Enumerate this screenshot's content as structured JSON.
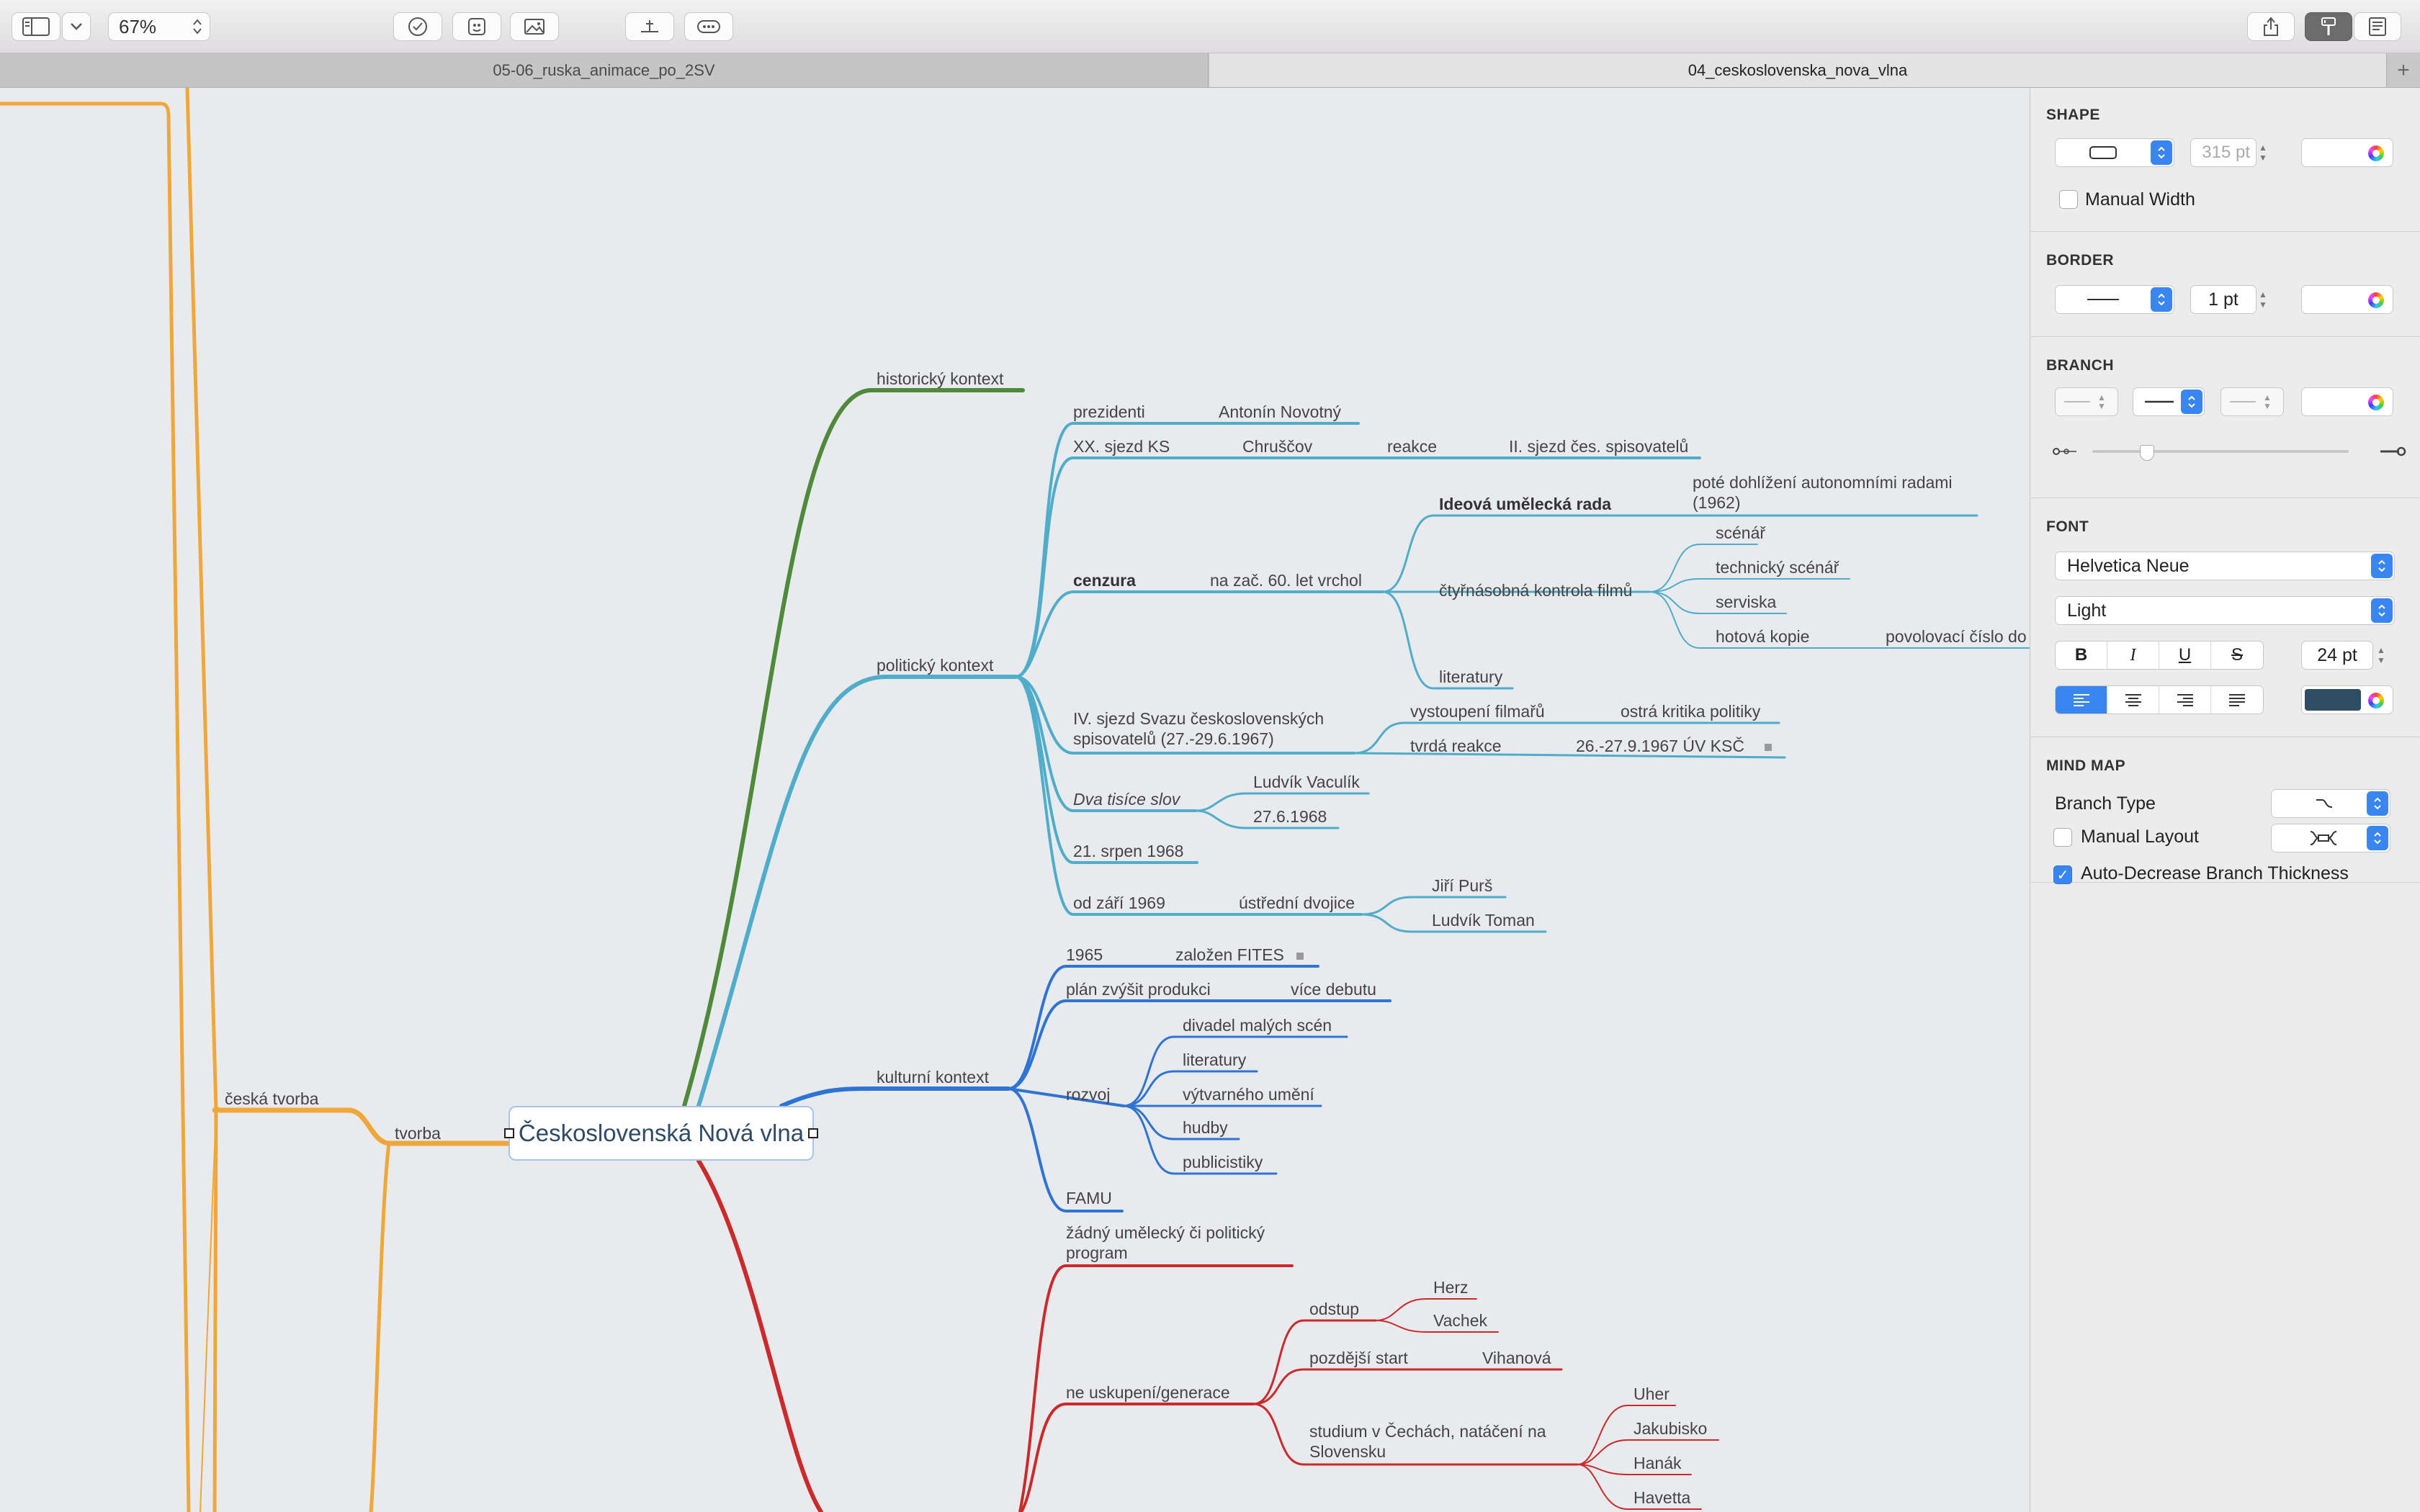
{
  "toolbar": {
    "zoom": "67%",
    "icons": [
      "sidebar-icon",
      "chevron-down-icon",
      "checkmark-icon",
      "sticker-icon",
      "image-icon",
      "add-subtopic-icon",
      "relationship-icon",
      "share-icon",
      "format-brush-icon",
      "document-icon"
    ]
  },
  "tabs": [
    "05-06_ruska_animace_po_2SV",
    "04_ceskoslovenska_nova_vlna"
  ],
  "colors": {
    "orange": "#f0a73a",
    "green": "#4e8a3a",
    "teal": "#4fadca",
    "blue": "#2f74d2",
    "red": "#cc2a2a",
    "accent": "#3a86f0"
  },
  "mindmap": {
    "central": "Československá Nová vlna",
    "left": {
      "ceska_tvorba": "česká tvorba",
      "tvorba": "tvorba"
    },
    "historicky": "historický kontext",
    "politicky": {
      "label": "politický kontext",
      "prezidenti": "prezidenti",
      "novotny": "Antonín Novotný",
      "xx_sjezd": "XX. sjezd KS",
      "chruscov": "Chruščov",
      "reakce": "reakce",
      "ii_sjezd": "II. sjezd čes. spisovatelů",
      "cenzura": "cenzura",
      "vrchol": "na zač. 60. let vrchol",
      "ideova": "Ideová umělecká rada",
      "pote": "poté dohlížení autonomními radami (1962)",
      "ctyrnasobna": "čtyřnásobná kontrola filmů",
      "scenar": "scénář",
      "technicky": "technický scénář",
      "serviska": "serviska",
      "hotova": "hotová kopie",
      "povolovaci": "povolovací číslo do",
      "literatury": "literatury",
      "iv_sjezd": "IV. sjezd Svazu československých spisovatelů (27.-29.6.1967)",
      "vystoupeni": "vystoupení filmařů",
      "ostra": "ostrá kritika politiky",
      "tvrda": "tvrdá reakce",
      "uv_ksc": "26.-27.9.1967 ÚV KSČ",
      "dva_tisice": "Dva tisíce slov",
      "vaculik": "Ludvík Vaculík",
      "datum_dts": "27.6.1968",
      "srpen": "21. srpen 1968",
      "od_zari": "od září 1969",
      "ustredni": "ústřední dvojice",
      "purs": "Jiří Purš",
      "toman": "Ludvík Toman"
    },
    "kulturni": {
      "label": "kulturní kontext",
      "rok_1965": "1965",
      "fites": "založen FITES",
      "plan": "plán zvýšit produkci",
      "vice_debutu": "více debutu",
      "rozvoj": "rozvoj",
      "divadel": "divadel malých scén",
      "literatury": "literatury",
      "vytvarneho": "výtvarného umění",
      "hudby": "hudby",
      "publicistiky": "publicistiky",
      "famu": "FAMU"
    },
    "red": {
      "zadny": "žádný umělecký či politický program",
      "ne_uskupeni": "ne uskupení/generace",
      "odstup": "odstup",
      "herz": "Herz",
      "vachek": "Vachek",
      "pozdejsi": "pozdější start",
      "vihanova": "Vihanová",
      "studium": "studium v Čechách, natáčení na Slovensku",
      "uher": "Uher",
      "jakubisko": "Jakubisko",
      "hanak": "Hanák",
      "havetta": "Havetta"
    }
  },
  "inspector": {
    "shape": {
      "title": "SHAPE",
      "width": "315 pt",
      "manual_width": "Manual Width"
    },
    "border": {
      "title": "BORDER",
      "size": "1 pt"
    },
    "branch": {
      "title": "BRANCH"
    },
    "font": {
      "title": "FONT",
      "family": "Helvetica Neue",
      "style": "Light",
      "bold": "B",
      "italic": "I",
      "underline": "U",
      "strike": "S",
      "size": "24 pt",
      "text_color": "#2d4e63"
    },
    "mindmap": {
      "title": "MIND MAP",
      "branch_type": "Branch Type",
      "manual_layout": "Manual Layout",
      "auto_decrease": "Auto-Decrease Branch Thickness",
      "auto_decrease_checked": true,
      "manual_layout_checked": false
    }
  }
}
